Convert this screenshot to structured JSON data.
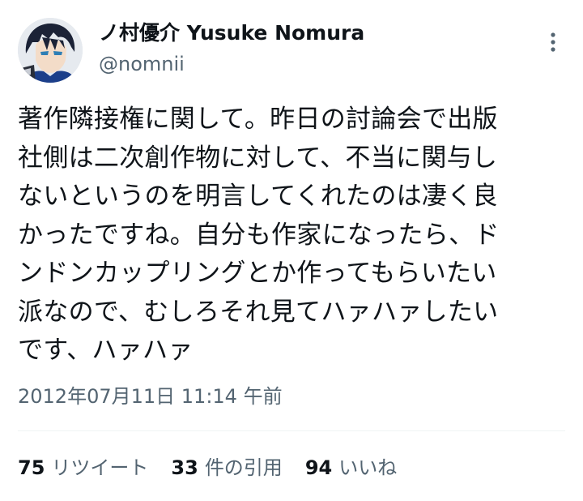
{
  "author": {
    "display_name": "ノ村優介 Yusuke Nomura",
    "handle": "@nomnii"
  },
  "tweet": {
    "text": "著作隣接権に関して。昨日の討論会で出版\n社側は二次創作物に対して、不当に関与し\nないというのを明言してくれたのは凄く良\nかったですね。自分も作家になったら、ド\nンドンカップリングとか作ってもらいたい\n派なので、むしろそれ見てハァハァしたい\nです、ハァハァ",
    "timestamp": "2012年07月11日 11:14 午前"
  },
  "stats": {
    "retweets_count": "75",
    "retweets_label": "リツイート",
    "quotes_count": "33",
    "quotes_label": "件の引用",
    "likes_count": "94",
    "likes_label": "いいね"
  },
  "icons": {
    "more": "more-vertical-icon",
    "avatar": "avatar"
  },
  "colors": {
    "text_primary": "#0f1419",
    "text_secondary": "#536471",
    "divider": "#eff3f4"
  }
}
